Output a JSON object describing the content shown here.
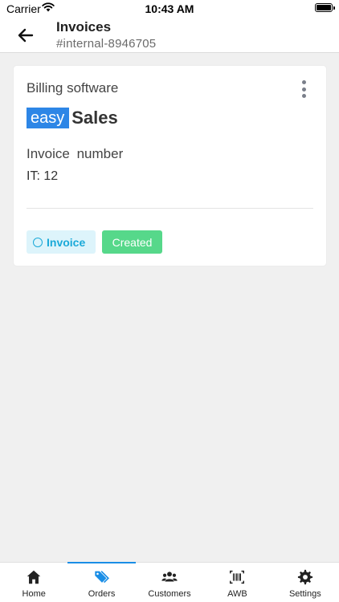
{
  "status_bar": {
    "carrier": "Carrier",
    "time": "10:43 AM"
  },
  "header": {
    "title": "Invoices",
    "subtitle": "#internal-8946705"
  },
  "card": {
    "billing_label": "Billing software",
    "logo": {
      "part1": "easy",
      "part2": "Sales"
    },
    "invoice_number_label": "Invoice number",
    "invoice_number_value": "IT: 12",
    "type_badge": "Invoice",
    "status_badge": "Created"
  },
  "tabs": [
    {
      "label": "Home",
      "icon": "home-icon"
    },
    {
      "label": "Orders",
      "icon": "tag-icon",
      "active": true
    },
    {
      "label": "Customers",
      "icon": "users-icon"
    },
    {
      "label": "AWB",
      "icon": "barcode-icon"
    },
    {
      "label": "Settings",
      "icon": "gear-icon"
    }
  ],
  "colors": {
    "accent": "#1a8ee6",
    "logo_blue": "#2d86e6",
    "status_created": "#56d88a",
    "type_badge_text": "#1aa9d8",
    "type_badge_bg": "#ddf4fb",
    "background": "#f0f0f0"
  }
}
